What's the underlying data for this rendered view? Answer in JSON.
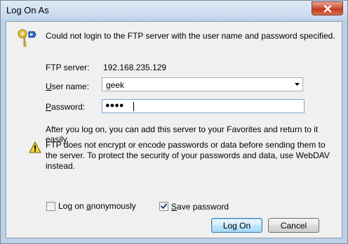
{
  "window": {
    "title": "Log On As"
  },
  "message": "Could not login to the FTP server with the user name and password specified.",
  "server": {
    "label": "FTP server:",
    "value": "192.168.235.129"
  },
  "username": {
    "label_accel": "U",
    "label_rest": "ser name:",
    "value": "geek"
  },
  "password": {
    "label_accel": "P",
    "label_rest": "assword:",
    "value_masked": "●●●●"
  },
  "favorites_note": "After you log on, you can add this server to your Favorites and return to it easily.",
  "warning": "FTP does not encrypt or encode passwords or data before sending them to the server.  To protect the security of your passwords and data, use WebDAV instead.",
  "anonymous": {
    "label_pre": "Log on ",
    "label_accel": "a",
    "label_post": "nonymously",
    "checked": false
  },
  "save_password": {
    "label_accel": "S",
    "label_rest": "ave password",
    "checked": true
  },
  "buttons": {
    "logon": "Log On",
    "cancel": "Cancel"
  },
  "icons": {
    "close": "close-icon",
    "keys": "keys-icon",
    "warning": "warning-icon",
    "dropdown": "chevron-down-icon",
    "check": "check-icon"
  }
}
